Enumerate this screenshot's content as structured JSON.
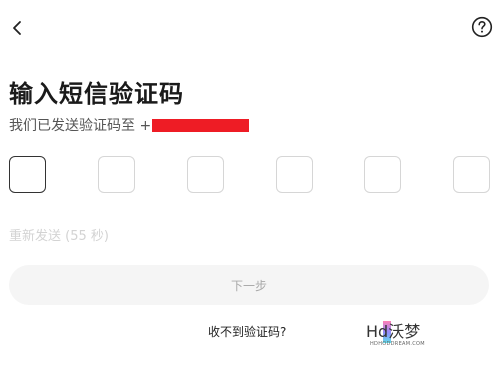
{
  "header": {
    "back_icon": "chevron-left-icon",
    "help_icon": "question-circle-icon"
  },
  "title": "输入短信验证码",
  "subtitle": {
    "text": "我们已发送验证码至 +",
    "phone_redacted": true
  },
  "code_boxes": [
    "",
    "",
    "",
    "",
    "",
    ""
  ],
  "resend_label": "重新发送 (55 秒)",
  "next_label": "下一步",
  "no_code_label": "收不到验证码?",
  "watermark": {
    "main": "Hd沃梦",
    "sub": "HDHODDREAM.COM"
  },
  "colors": {
    "redaction": "#ee1c25",
    "disabled_text": "#d3d3d3",
    "button_bg": "#f5f5f5"
  }
}
